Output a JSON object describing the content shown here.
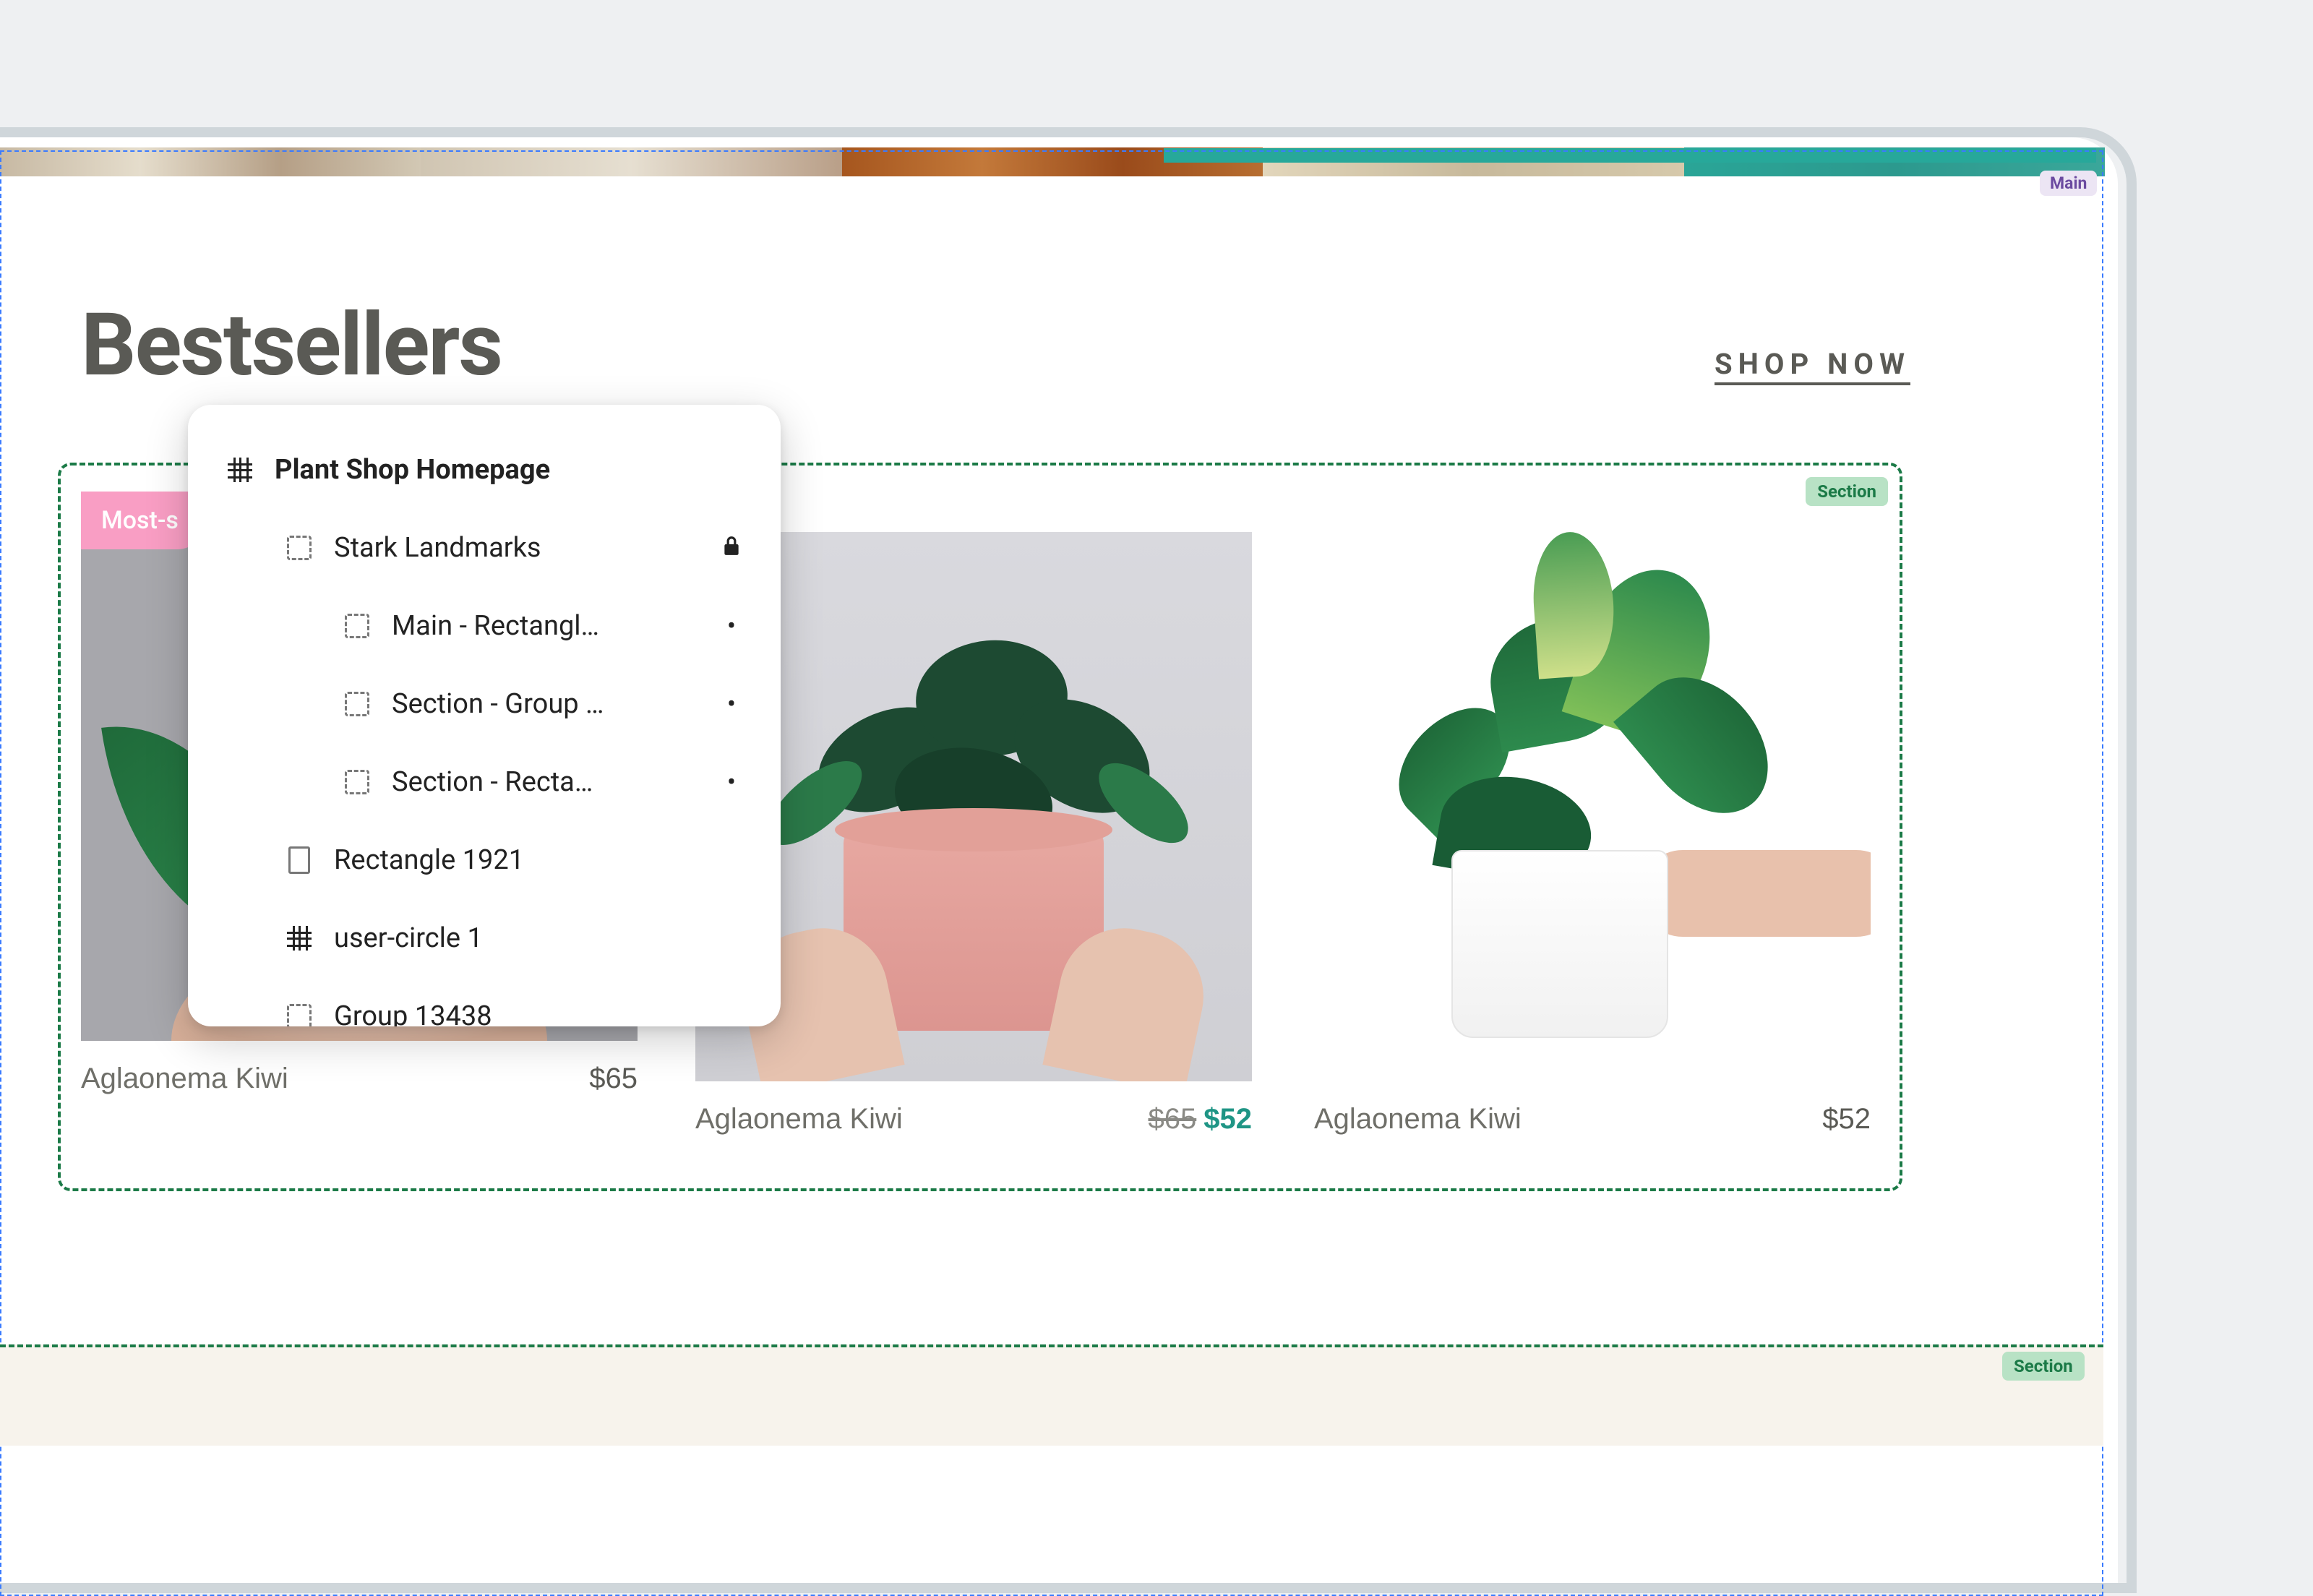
{
  "labels": {
    "main_tag": "Main",
    "section_tag": "Section",
    "section_tag_2": "Section"
  },
  "page": {
    "title": "Bestsellers",
    "shop_now": "SHOP NOW"
  },
  "products": [
    {
      "name": "Aglaonema Kiwi",
      "price": "$65",
      "badge": "Most-s"
    },
    {
      "name": "Aglaonema Kiwi",
      "old_price": "$65",
      "new_price": "$52"
    },
    {
      "name": "Aglaonema Kiwi",
      "price": "$52"
    }
  ],
  "layer_tree": {
    "root": "Plant Shop Homepage",
    "items": [
      {
        "label": "Stark Landmarks",
        "trail": "lock"
      },
      {
        "label": "Main - Rectangl…",
        "trail": "dot"
      },
      {
        "label": "Section - Group …",
        "trail": "dot"
      },
      {
        "label": "Section - Recta…",
        "trail": "dot"
      },
      {
        "label": "Rectangle 1921"
      },
      {
        "label": "user-circle 1"
      },
      {
        "label": "Group 13438"
      }
    ]
  }
}
